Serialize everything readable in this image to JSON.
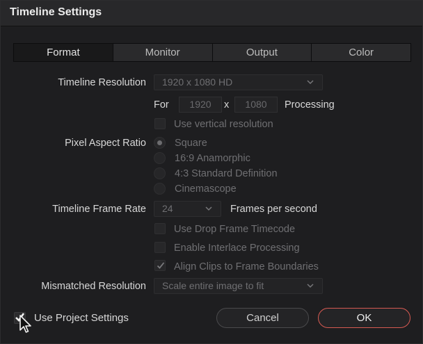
{
  "window": {
    "title": "Timeline Settings"
  },
  "tabs": [
    {
      "label": "Format",
      "active": true
    },
    {
      "label": "Monitor",
      "active": false
    },
    {
      "label": "Output",
      "active": false
    },
    {
      "label": "Color",
      "active": false
    }
  ],
  "resolution": {
    "label": "Timeline Resolution",
    "selected": "1920 x 1080 HD",
    "for_label": "For",
    "width": "1920",
    "x_label": "x",
    "height": "1080",
    "processing_label": "Processing",
    "vertical_label": "Use vertical resolution",
    "vertical_checked": false
  },
  "pixel_aspect": {
    "label": "Pixel Aspect Ratio",
    "options": [
      {
        "label": "Square",
        "selected": true
      },
      {
        "label": "16:9 Anamorphic",
        "selected": false
      },
      {
        "label": "4:3 Standard Definition",
        "selected": false
      },
      {
        "label": "Cinemascope",
        "selected": false
      }
    ]
  },
  "frame_rate": {
    "label": "Timeline Frame Rate",
    "selected": "24",
    "unit_label": "Frames per second",
    "drop_frame_label": "Use Drop Frame Timecode",
    "drop_frame_checked": false,
    "interlace_label": "Enable Interlace Processing",
    "interlace_checked": false,
    "align_clips_label": "Align Clips to Frame Boundaries",
    "align_clips_checked": true
  },
  "mismatched": {
    "label": "Mismatched Resolution",
    "selected": "Scale entire image to fit"
  },
  "footer": {
    "use_project_label": "Use Project Settings",
    "use_project_checked": true,
    "cancel_label": "Cancel",
    "ok_label": "OK"
  },
  "colors": {
    "accent_ok_border": "#d65a52",
    "background": "#1e1e20",
    "disabled_text": "#6f6f72"
  },
  "icons": [
    "chevron-down-icon",
    "checkmark-icon",
    "mouse-cursor-icon"
  ]
}
